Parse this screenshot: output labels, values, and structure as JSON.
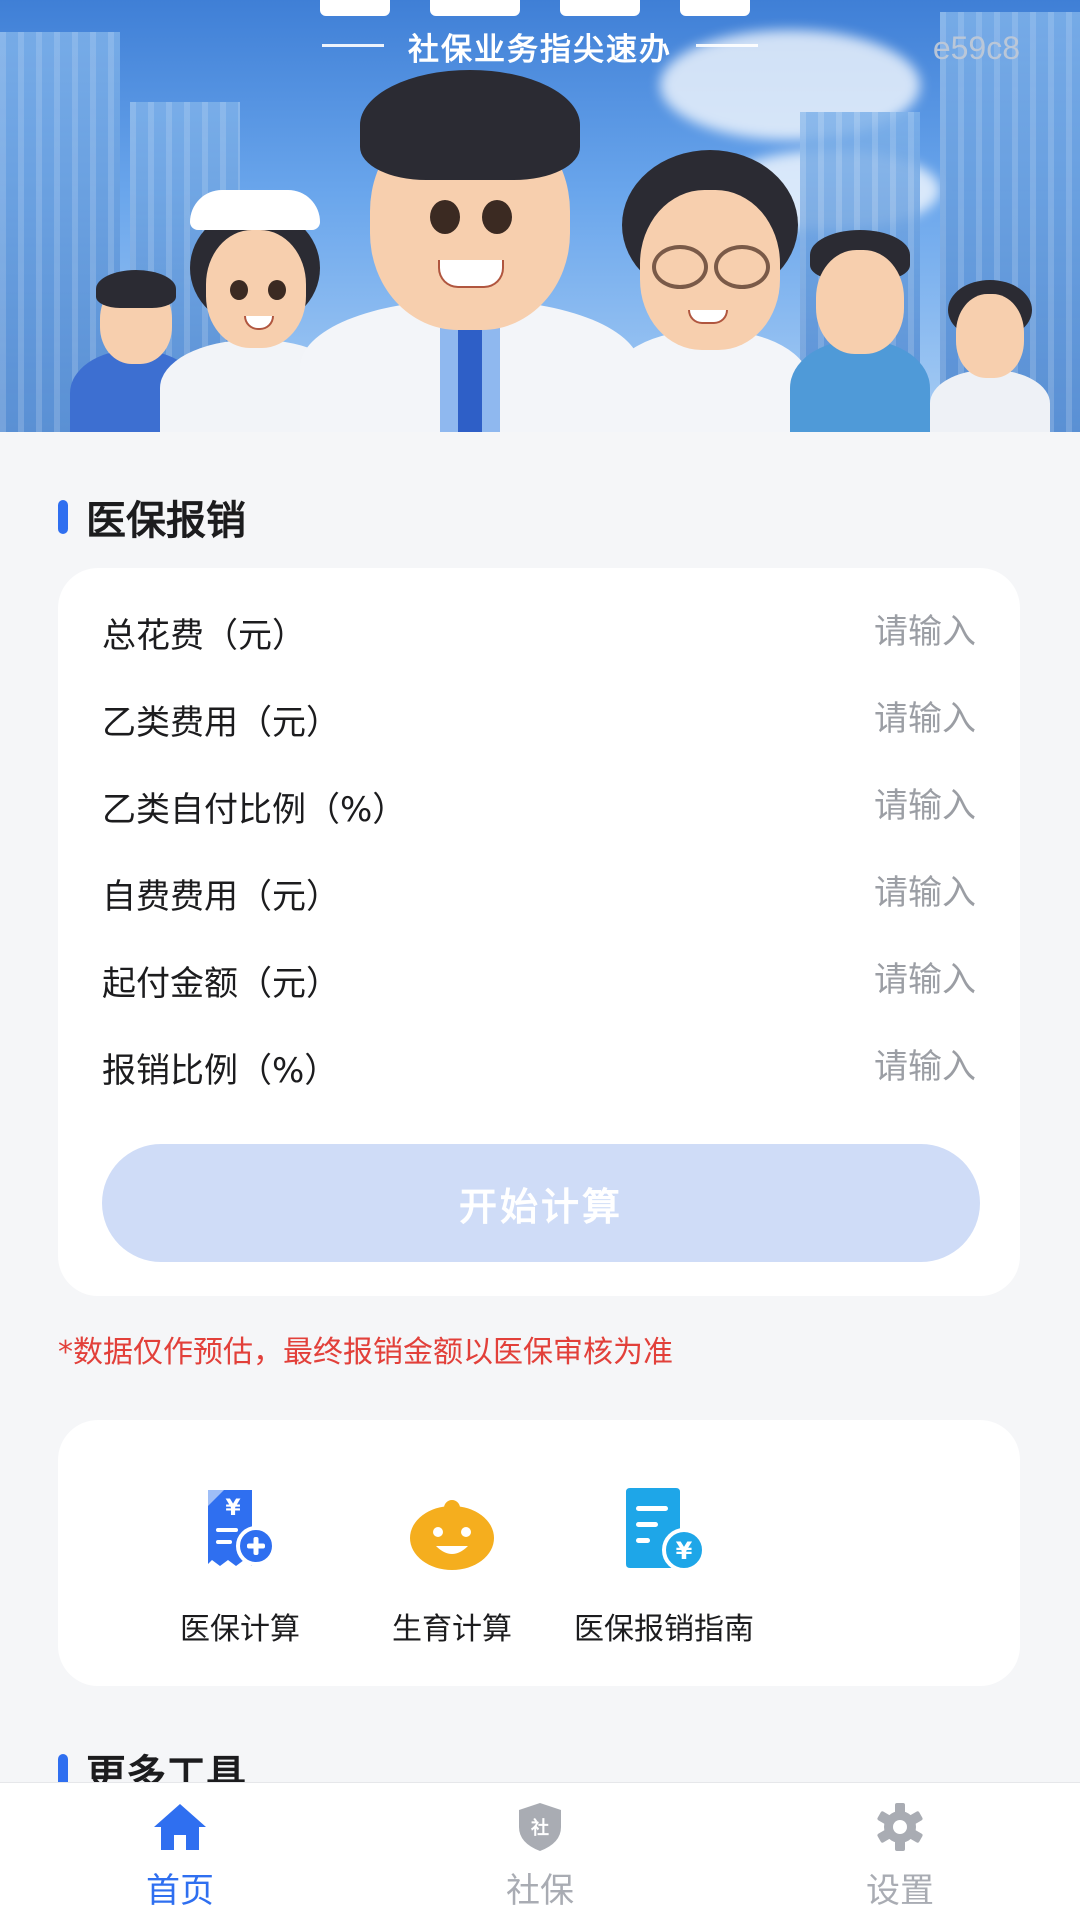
{
  "hero": {
    "subtitle": "社保业务指尖速办",
    "code": "e59c8"
  },
  "reimbursement": {
    "section_title": "医保报销",
    "fields": [
      {
        "label": "总花费（元）",
        "placeholder": "请输入"
      },
      {
        "label": "乙类费用（元）",
        "placeholder": "请输入"
      },
      {
        "label": "乙类自付比例（%）",
        "placeholder": "请输入"
      },
      {
        "label": "自费费用（元）",
        "placeholder": "请输入"
      },
      {
        "label": "起付金额（元）",
        "placeholder": "请输入"
      },
      {
        "label": "报销比例（%）",
        "placeholder": "请输入"
      }
    ],
    "calculate_label": "开始计算",
    "disclaimer": "*数据仅作预估，最终报销金额以医保审核为准"
  },
  "tools": [
    {
      "name": "医保计算",
      "icon": "medical-bill-icon"
    },
    {
      "name": "生育计算",
      "icon": "baby-face-icon"
    },
    {
      "name": "医保报销指南",
      "icon": "reimbursement-guide-icon"
    }
  ],
  "more_tools": {
    "section_title": "更多工具"
  },
  "tabbar": {
    "items": [
      {
        "label": "首页",
        "icon": "home-icon",
        "active": true
      },
      {
        "label": "社保",
        "icon": "shield-icon",
        "active": false
      },
      {
        "label": "设置",
        "icon": "gear-icon",
        "active": false
      }
    ]
  },
  "colors": {
    "accent": "#2f6ff0",
    "button_disabled": "#cfdcf7",
    "warning": "#e2403a",
    "placeholder": "#9b9ea4",
    "tab_inactive": "#a9acb3"
  },
  "icon_chars": {
    "yen": "¥",
    "shield_text": "社"
  }
}
